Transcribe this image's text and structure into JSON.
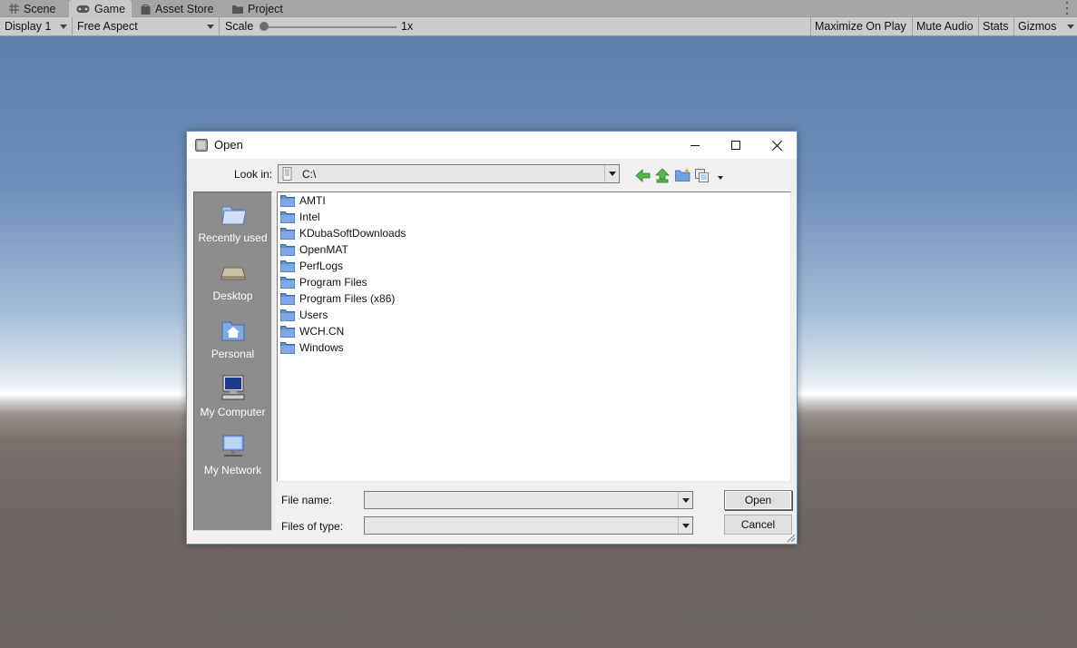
{
  "unity": {
    "tabs": [
      {
        "label": "Scene",
        "icon": "grid-icon"
      },
      {
        "label": "Game",
        "icon": "gamepad-icon"
      },
      {
        "label": "Asset Store",
        "icon": "bag-icon"
      },
      {
        "label": "Project",
        "icon": "folder-icon"
      }
    ],
    "toolbar": {
      "display": "Display 1",
      "aspect": "Free Aspect",
      "scale_label": "Scale",
      "scale_value": "1x",
      "scale_level": 0,
      "maximize": "Maximize On Play",
      "mute": "Mute Audio",
      "stats": "Stats",
      "gizmos": "Gizmos"
    }
  },
  "dialog": {
    "title": "Open",
    "look_in_label": "Look in:",
    "look_in_value": "C:\\",
    "sidebar": [
      {
        "label": "Recently used",
        "icon": "recent-folder-icon"
      },
      {
        "label": "Desktop",
        "icon": "desktop-icon"
      },
      {
        "label": "Personal",
        "icon": "home-folder-icon"
      },
      {
        "label": "My Computer",
        "icon": "computer-icon"
      },
      {
        "label": "My Network",
        "icon": "network-icon"
      }
    ],
    "files": [
      "AMTI",
      "Intel",
      "KDubaSoftDownloads",
      "OpenMAT",
      "PerfLogs",
      "Program Files",
      "Program Files (x86)",
      "Users",
      "WCH.CN",
      "Windows"
    ],
    "file_name_label": "File name:",
    "file_name_value": "",
    "files_of_type_label": "Files of type:",
    "files_of_type_value": "",
    "open_label": "Open",
    "cancel_label": "Cancel"
  },
  "colors": {
    "sidebar_bg": "#8c8c8c",
    "dialog_bg": "#f0f0f0",
    "folder_blue": "#5b8ed6"
  }
}
